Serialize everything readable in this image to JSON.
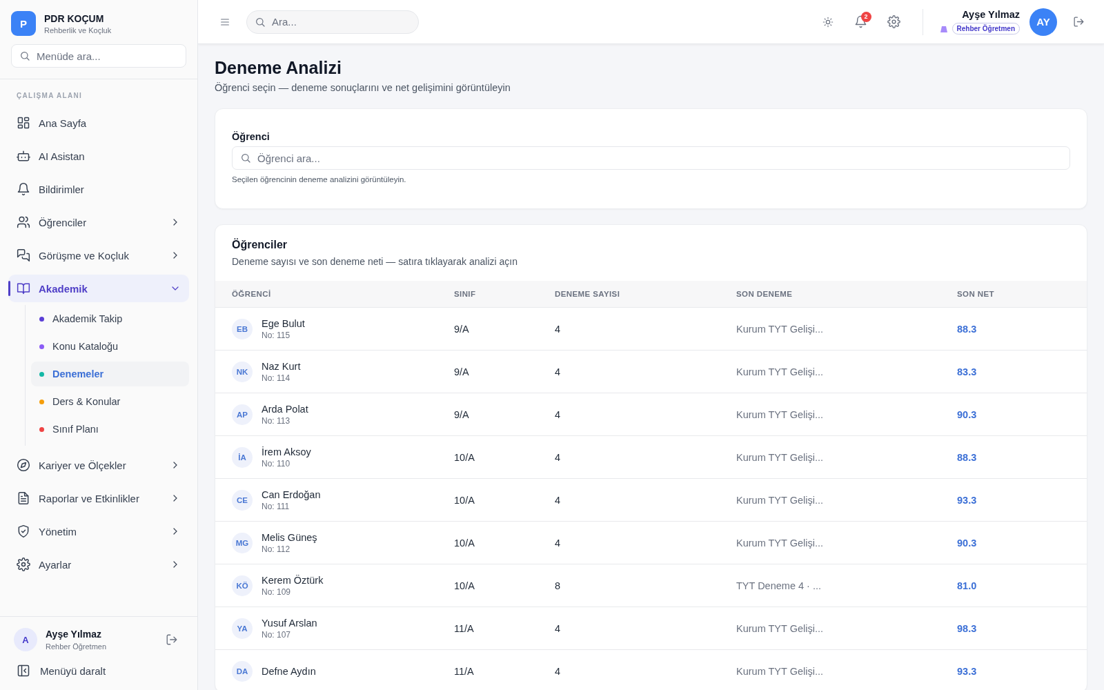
{
  "brand": {
    "logo": "P",
    "name": "PDR KOÇUM",
    "tagline": "Rehberlik ve Koçluk"
  },
  "sidebar": {
    "search_placeholder": "Menüde ara...",
    "section": "ÇALIŞMA ALANI",
    "items": [
      {
        "label": "Ana Sayfa",
        "kind": "link",
        "selected": false
      },
      {
        "label": "AI Asistan",
        "kind": "link",
        "selected": false
      },
      {
        "label": "Bildirimler",
        "kind": "link",
        "selected": false
      },
      {
        "label": "Öğrenciler",
        "kind": "group",
        "expanded": false,
        "selected": false
      },
      {
        "label": "Görüşme ve Koçluk",
        "kind": "group",
        "expanded": false,
        "selected": false
      },
      {
        "label": "Akademik",
        "kind": "group",
        "expanded": true,
        "selected": true,
        "children": [
          {
            "label": "Akademik Takip",
            "color": "#5b3fd6",
            "selected": false
          },
          {
            "label": "Konu Kataloğu",
            "color": "#8b5cf6",
            "selected": false
          },
          {
            "label": "Denemeler",
            "color": "#14b8a6",
            "selected": true
          },
          {
            "label": "Ders & Konular",
            "color": "#f59e0b",
            "selected": false
          },
          {
            "label": "Sınıf Planı",
            "color": "#ef4444",
            "selected": false
          }
        ]
      },
      {
        "label": "Kariyer ve Ölçekler",
        "kind": "group",
        "expanded": false,
        "selected": false
      },
      {
        "label": "Raporlar ve Etkinlikler",
        "kind": "group",
        "expanded": false,
        "selected": false
      },
      {
        "label": "Yönetim",
        "kind": "group",
        "expanded": false,
        "selected": false
      },
      {
        "label": "Ayarlar",
        "kind": "group",
        "expanded": false,
        "selected": false
      }
    ],
    "user": {
      "initial": "A",
      "name": "Ayşe Yılmaz",
      "role": "Rehber Öğretmen"
    },
    "collapse_label": "Menüyü daralt"
  },
  "topbar": {
    "search_placeholder": "Ara...",
    "notification_count": "2",
    "user_name": "Ayşe Yılmaz",
    "role_badge": "Rehber Öğretmen",
    "avatar": "AY"
  },
  "page": {
    "title": "Deneme Analizi",
    "subtitle": "Öğrenci seçin — deneme sonuçlarını ve net gelişimini görüntüleyin"
  },
  "student_picker": {
    "label": "Öğrenci",
    "placeholder": "Öğrenci ara...",
    "hint": "Seçilen öğrencinin deneme analizini görüntüleyin."
  },
  "table": {
    "title": "Öğrenciler",
    "subtitle": "Deneme sayısı ve son deneme neti — satıra tıklayarak analizi açın",
    "columns": [
      "ÖĞRENCİ",
      "SINIF",
      "DENEME SAYISI",
      "SON DENEME",
      "SON NET"
    ],
    "rows": [
      {
        "initials": "EB",
        "name": "Ege Bulut",
        "number": "No: 115",
        "class": "9/A",
        "count": "4",
        "last_exam": "Kurum TYT Gelişi...",
        "net": "88.3"
      },
      {
        "initials": "NK",
        "name": "Naz Kurt",
        "number": "No: 114",
        "class": "9/A",
        "count": "4",
        "last_exam": "Kurum TYT Gelişi...",
        "net": "83.3"
      },
      {
        "initials": "AP",
        "name": "Arda Polat",
        "number": "No: 113",
        "class": "9/A",
        "count": "4",
        "last_exam": "Kurum TYT Gelişi...",
        "net": "90.3"
      },
      {
        "initials": "İA",
        "name": "İrem Aksoy",
        "number": "No: 110",
        "class": "10/A",
        "count": "4",
        "last_exam": "Kurum TYT Gelişi...",
        "net": "88.3"
      },
      {
        "initials": "CE",
        "name": "Can Erdoğan",
        "number": "No: 111",
        "class": "10/A",
        "count": "4",
        "last_exam": "Kurum TYT Gelişi...",
        "net": "93.3"
      },
      {
        "initials": "MG",
        "name": "Melis Güneş",
        "number": "No: 112",
        "class": "10/A",
        "count": "4",
        "last_exam": "Kurum TYT Gelişi...",
        "net": "90.3"
      },
      {
        "initials": "KÖ",
        "name": "Kerem Öztürk",
        "number": "No: 109",
        "class": "10/A",
        "count": "8",
        "last_exam": "TYT Deneme 4 · ...",
        "net": "81.0"
      },
      {
        "initials": "YA",
        "name": "Yusuf Arslan",
        "number": "No: 107",
        "class": "11/A",
        "count": "4",
        "last_exam": "Kurum TYT Gelişi...",
        "net": "98.3"
      },
      {
        "initials": "DA",
        "name": "Defne Aydın",
        "class": "11/A",
        "count": "4",
        "last_exam": "Kurum TYT Gelişi...",
        "net": "93.3"
      }
    ]
  }
}
